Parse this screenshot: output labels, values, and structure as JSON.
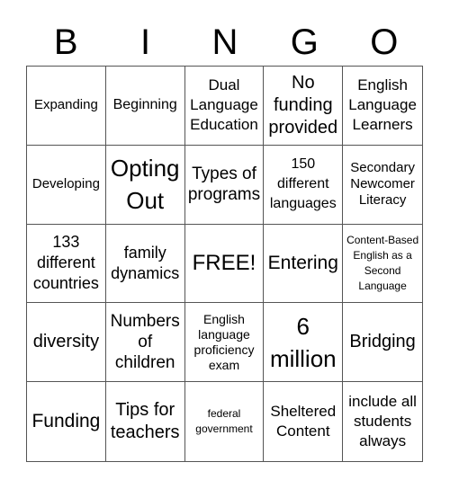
{
  "title_letters": [
    "B",
    "I",
    "N",
    "G",
    "O"
  ],
  "cells": [
    "Expanding",
    "Beginning",
    "Dual Language Education",
    "No funding provided",
    "English Language Learners",
    "Developing",
    "Opting Out",
    "Types of programs",
    "150 different languages",
    "Secondary Newcomer Literacy",
    "133 different countries",
    "family dynamics",
    "FREE!",
    "Entering",
    "Content-Based English as a Second Language",
    "diversity",
    "Numbers of children",
    "English language proficiency exam",
    "6 million",
    "Bridging",
    "Funding",
    "Tips for teachers",
    "federal government",
    "Sheltered Content",
    "include all students always"
  ]
}
